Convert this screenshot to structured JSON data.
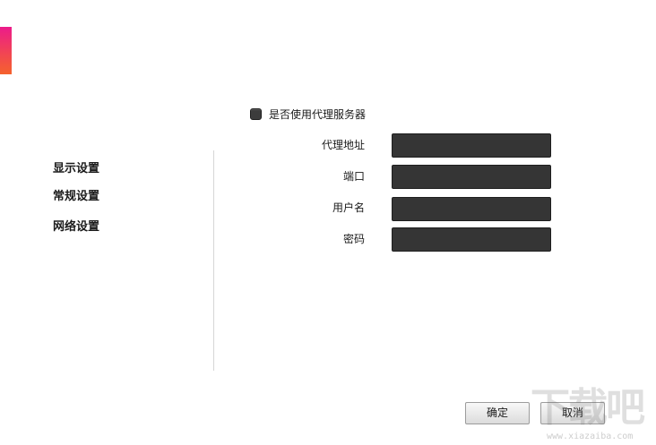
{
  "sidebar": {
    "items": [
      {
        "label": "显示设置"
      },
      {
        "label": "常规设置"
      },
      {
        "label": "网络设置"
      }
    ]
  },
  "proxy": {
    "use_proxy_label": "是否使用代理服务器",
    "use_proxy_checked": false,
    "fields": [
      {
        "label": "代理地址",
        "value": ""
      },
      {
        "label": "端口",
        "value": ""
      },
      {
        "label": "用户名",
        "value": ""
      },
      {
        "label": "密码",
        "value": ""
      }
    ]
  },
  "buttons": {
    "ok_label": "确定",
    "cancel_label": "取消"
  },
  "watermark": {
    "text": "下载吧",
    "url": "www.xiazaiba.com"
  },
  "colors": {
    "accent_top": "#ec1b8a",
    "accent_bottom": "#f5622d",
    "input_bg": "#353535"
  }
}
